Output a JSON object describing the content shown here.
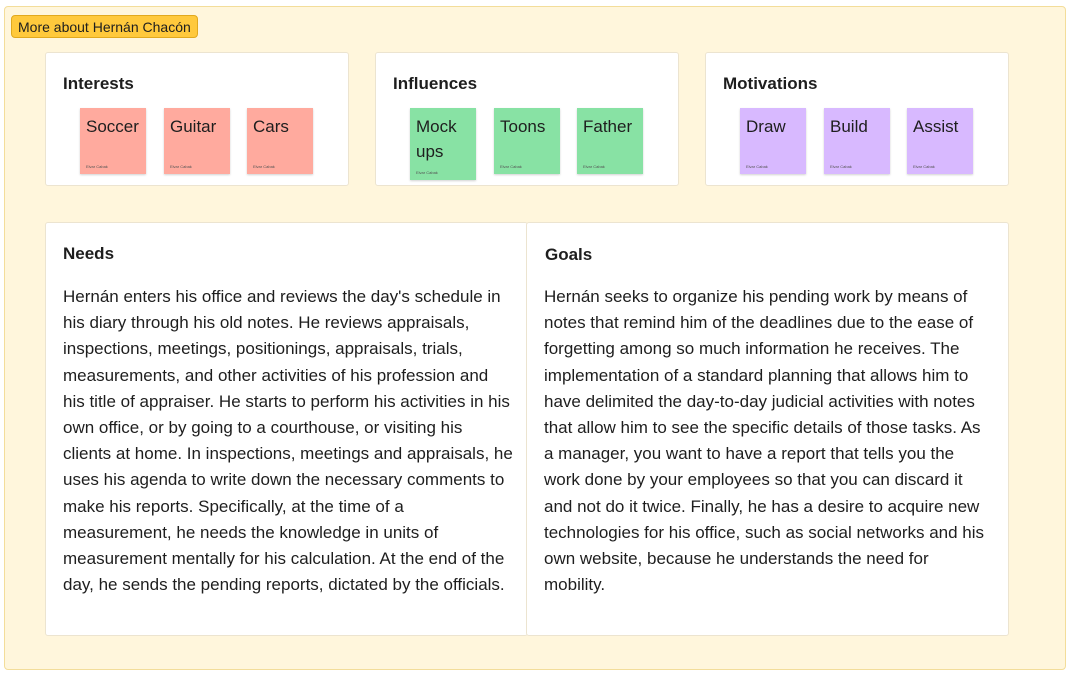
{
  "frame": {
    "title": "More about Hernán Chacón"
  },
  "interests": {
    "title": "Interests",
    "stickies": [
      {
        "text": "Soccer",
        "author": "Elvar Cabak"
      },
      {
        "text": "Guitar",
        "author": "Elvar Cabak"
      },
      {
        "text": "Cars",
        "author": "Elvar Cabak"
      }
    ]
  },
  "influences": {
    "title": "Influences",
    "stickies": [
      {
        "text": "Mock ups",
        "author": "Elvar Cabak"
      },
      {
        "text": "Toons",
        "author": "Elvar Cabak"
      },
      {
        "text": "Father",
        "author": "Elvar Cabak"
      }
    ]
  },
  "motivations": {
    "title": "Motivations",
    "stickies": [
      {
        "text": "Draw",
        "author": "Elvar Cabak"
      },
      {
        "text": "Build",
        "author": "Elvar Cabak"
      },
      {
        "text": "Assist",
        "author": "Elvar Cabak"
      }
    ]
  },
  "needs": {
    "title": "Needs",
    "body": "Hernán enters his office and reviews the day's schedule in his diary through his old notes. He reviews appraisals, inspections, meetings, positionings, appraisals, trials, measurements, and other activities of his profession and his title of appraiser. He starts to perform his activities in his own office, or by going to a courthouse, or visiting his clients at home. In inspections, meetings and appraisals, he uses his agenda to write down the necessary comments to make his reports. Specifically, at the time of a measurement, he needs the knowledge in units of measurement mentally for his calculation. At the end of the day, he sends the pending reports, dictated by the officials."
  },
  "goals": {
    "title": "Goals",
    "body": "Hernán seeks to organize his pending work by means of notes that remind him of the deadlines due to the ease of forgetting among so much information he receives. The implementation of a standard planning that allows him to have delimited the day-to-day judicial activities with notes that allow him to see the specific details of those tasks. As a manager, you want to have a report that tells you the work done by your employees so that you can discard it and not do it twice. Finally, he has a desire to acquire new technologies for his office, such as social networks and his own website, because he understands the need for mobility."
  },
  "colors": {
    "frame_bg": "#fff6dc",
    "frame_tag": "#ffc93c",
    "sticky_pink": "#ffaa9e",
    "sticky_green": "#88e2a4",
    "sticky_purple": "#d8b9ff"
  }
}
